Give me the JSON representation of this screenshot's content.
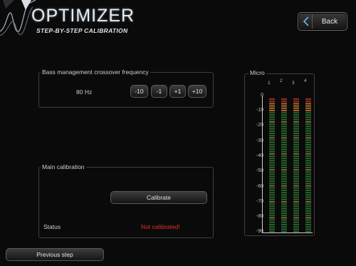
{
  "header": {
    "title": "OPTIMIZER",
    "subtitle": "STEP-BY-STEP CALIBRATION",
    "back_label": "Back"
  },
  "bass": {
    "legend": "Bass management crossover frequency",
    "value": "80 Hz",
    "buttons": [
      "-10",
      "-1",
      "+1",
      "+10"
    ]
  },
  "calibration": {
    "legend": "Main calibration",
    "button_label": "Calibrate",
    "status_label": "Status",
    "status_value": "Not calibrated!"
  },
  "meter": {
    "title": "Micro",
    "channels": [
      "1",
      "2",
      "3",
      "4"
    ],
    "scale": [
      "0",
      "-10",
      "-20",
      "-30",
      "-40",
      "-50",
      "-60",
      "-70",
      "-80",
      "-90"
    ],
    "levels_db": [
      -90,
      -90,
      -90,
      -90
    ],
    "colors": {
      "red": "#d2352a",
      "orange": "#e08a3a",
      "green": "#3fae4a",
      "yellow": "#d9c23a"
    }
  },
  "footer": {
    "prev_label": "Previous step"
  }
}
